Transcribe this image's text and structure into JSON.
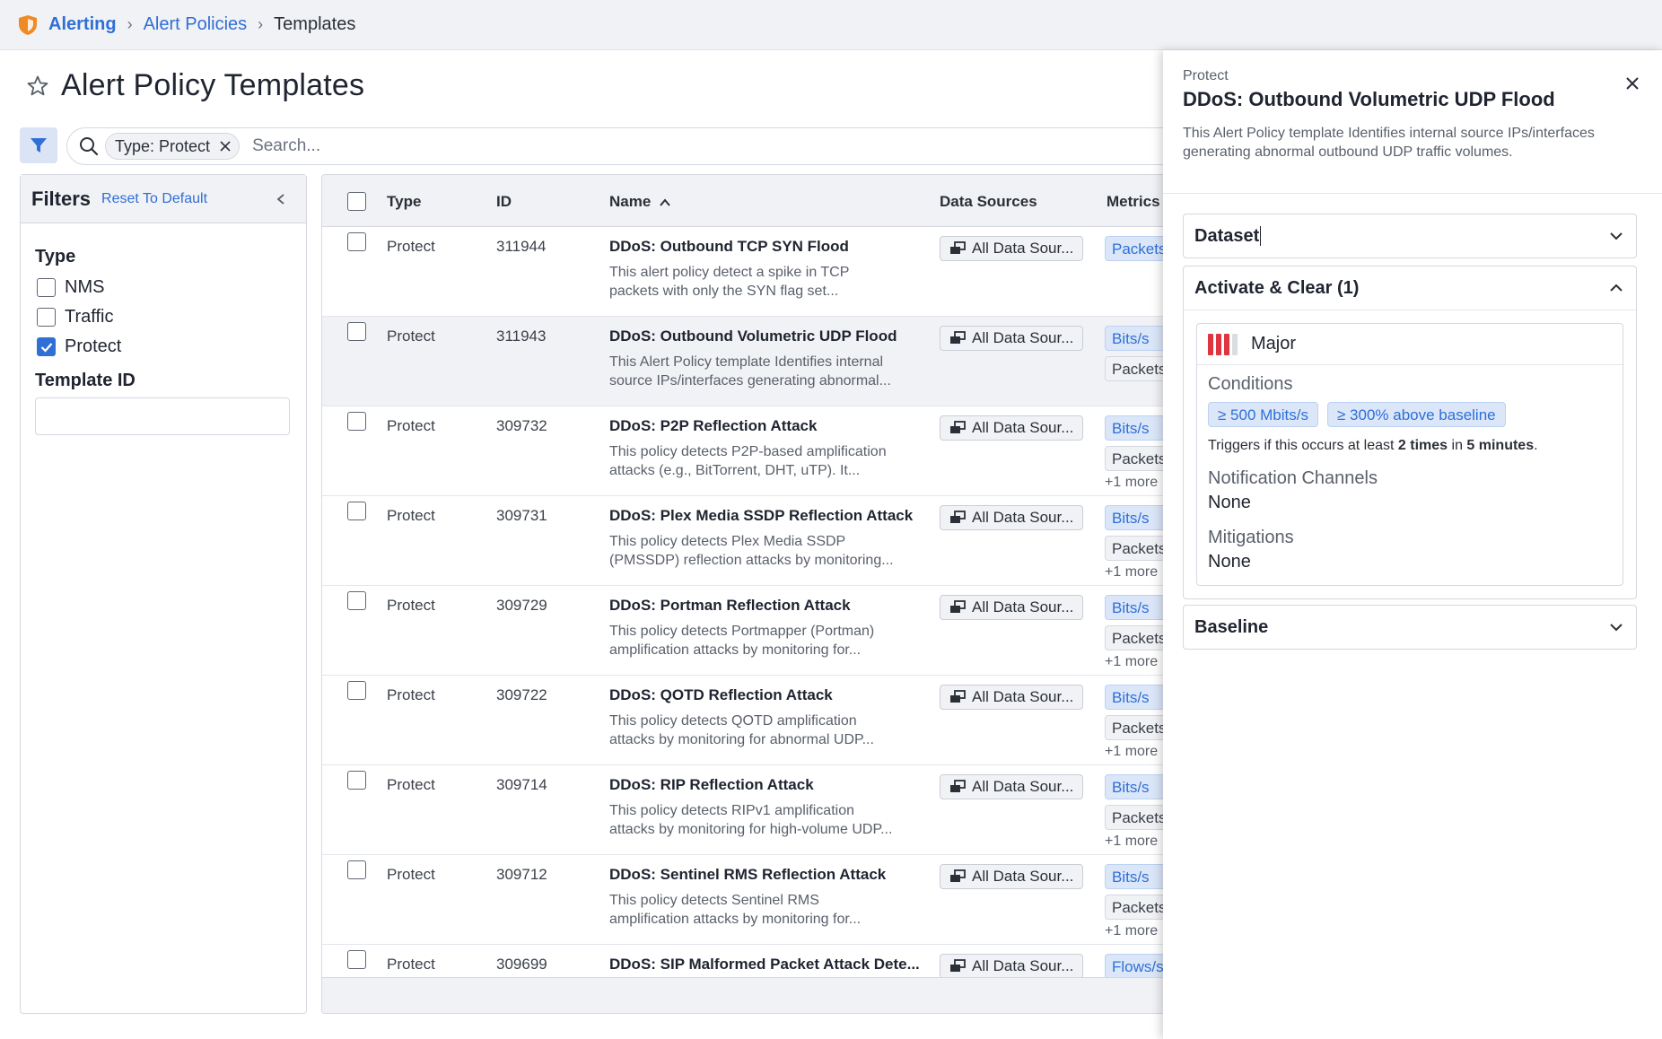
{
  "breadcrumb": {
    "items": [
      "Alerting",
      "Alert Policies"
    ],
    "current": "Templates"
  },
  "page": {
    "title": "Alert Policy Templates"
  },
  "search": {
    "chip_label": "Type: Protect",
    "placeholder": "Search..."
  },
  "filters": {
    "title": "Filters",
    "reset_label": "Reset To Default",
    "type_heading": "Type",
    "type_options": [
      {
        "label": "NMS",
        "checked": false
      },
      {
        "label": "Traffic",
        "checked": false
      },
      {
        "label": "Protect",
        "checked": true
      }
    ],
    "template_id_heading": "Template ID",
    "template_id_value": ""
  },
  "table": {
    "columns": {
      "type": "Type",
      "id": "ID",
      "name": "Name",
      "data_sources": "Data Sources",
      "metrics": "Metrics"
    },
    "rows": [
      {
        "type": "Protect",
        "id": "311944",
        "name": "DDoS: Outbound TCP SYN Flood",
        "desc1": "This alert policy detect a spike in TCP",
        "desc2": "packets with only the SYN flag set...",
        "data_source": "All Data Sour...",
        "metric1": "Packets/s",
        "metric2": "",
        "more": ""
      },
      {
        "type": "Protect",
        "id": "311943",
        "name": "DDoS: Outbound Volumetric UDP Flood",
        "desc1": "This Alert Policy template Identifies internal",
        "desc2": "source IPs/interfaces generating abnormal...",
        "data_source": "All Data Sour...",
        "metric1": "Bits/s",
        "metric2": "Packets/s",
        "more": ""
      },
      {
        "type": "Protect",
        "id": "309732",
        "name": "DDoS: P2P Reflection Attack",
        "desc1": "This policy detects P2P-based amplification",
        "desc2": "attacks (e.g., BitTorrent, DHT, uTP). It...",
        "data_source": "All Data Sour...",
        "metric1": "Bits/s",
        "metric2": "Packets/s",
        "more": "+1 more"
      },
      {
        "type": "Protect",
        "id": "309731",
        "name": "DDoS: Plex Media SSDP Reflection Attack",
        "desc1": "This policy detects Plex Media SSDP",
        "desc2": "(PMSSDP) reflection attacks by monitoring...",
        "data_source": "All Data Sour...",
        "metric1": "Bits/s",
        "metric2": "Packets/s",
        "more": "+1 more"
      },
      {
        "type": "Protect",
        "id": "309729",
        "name": "DDoS: Portman Reflection Attack",
        "desc1": "This policy detects Portmapper (Portman)",
        "desc2": "amplification attacks by monitoring for...",
        "data_source": "All Data Sour...",
        "metric1": "Bits/s",
        "metric2": "Packets/s",
        "more": "+1 more"
      },
      {
        "type": "Protect",
        "id": "309722",
        "name": "DDoS: QOTD Reflection Attack",
        "desc1": "This policy detects QOTD amplification",
        "desc2": "attacks by monitoring for abnormal UDP...",
        "data_source": "All Data Sour...",
        "metric1": "Bits/s",
        "metric2": "Packets/s",
        "more": "+1 more"
      },
      {
        "type": "Protect",
        "id": "309714",
        "name": "DDoS: RIP Reflection Attack",
        "desc1": "This policy detects RIPv1 amplification",
        "desc2": "attacks by monitoring for high-volume UDP...",
        "data_source": "All Data Sour...",
        "metric1": "Bits/s",
        "metric2": "Packets/s",
        "more": "+1 more"
      },
      {
        "type": "Protect",
        "id": "309712",
        "name": "DDoS: Sentinel RMS Reflection Attack",
        "desc1": "This policy detects Sentinel RMS",
        "desc2": "amplification attacks by monitoring for...",
        "data_source": "All Data Sour...",
        "metric1": "Bits/s",
        "metric2": "Packets/s",
        "more": "+1 more"
      },
      {
        "type": "Protect",
        "id": "309699",
        "name": "DDoS: SIP Malformed Packet Attack Dete...",
        "desc1": "",
        "desc2": "",
        "data_source": "All Data Sour...",
        "metric1": "Flows/s",
        "metric2": "",
        "more": ""
      }
    ]
  },
  "panel": {
    "kicker": "Protect",
    "title": "DDoS: Outbound Volumetric UDP Flood",
    "description": "This Alert Policy template Identifies internal source IPs/interfaces generating abnormal outbound UDP traffic volumes.",
    "dataset_label": "Dataset",
    "activate_label": "Activate & Clear (1)",
    "severity": "Major",
    "conditions_label": "Conditions",
    "condition1": "≥ 500 Mbits/s",
    "condition2": "≥ 300% above baseline",
    "trigger_prefix": "Triggers if this occurs at least ",
    "trigger_times": "2 times",
    "trigger_mid": " in ",
    "trigger_window": "5 minutes",
    "trigger_suffix": ".",
    "notification_label": "Notification Channels",
    "notification_value": "None",
    "mitigations_label": "Mitigations",
    "mitigations_value": "None",
    "baseline_label": "Baseline"
  },
  "colors": {
    "accent": "#2f6fd6",
    "severity_major": "#e0353f",
    "logo": "#f08a24"
  }
}
